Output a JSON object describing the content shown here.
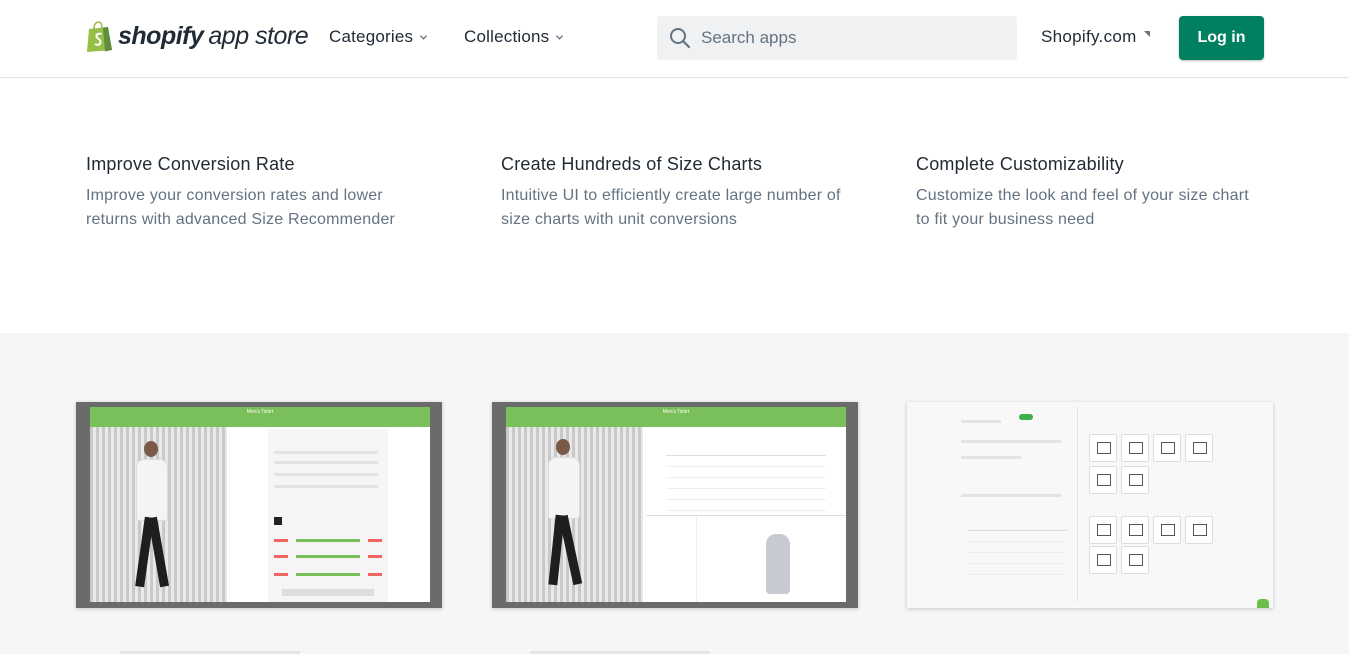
{
  "header": {
    "logo_word": "shopify",
    "logo_sub": "app store",
    "nav": [
      {
        "label": "Categories"
      },
      {
        "label": "Collections"
      }
    ],
    "search_placeholder": "Search apps",
    "shopify_link": "Shopify.com",
    "login_label": "Log in"
  },
  "features": [
    {
      "title": "Improve Conversion Rate",
      "desc": "Improve your conversion rates and lower returns with advanced Size Recommender"
    },
    {
      "title": "Create Hundreds of Size Charts",
      "desc": "Intuitive UI to efficiently create large number of size charts with unit conversions"
    },
    {
      "title": "Complete Customizability",
      "desc": "Customize the look and feel of your size chart to fit your business need"
    }
  ],
  "screenshots": [
    {
      "modal_title": "Men's Tshirt"
    },
    {
      "modal_title": "Men's Tshirt"
    },
    {
      "modal_title": ""
    }
  ],
  "colors": {
    "brand_green": "#008060",
    "accent_green": "#7ac05a",
    "text": "#212b36",
    "muted": "#637381"
  }
}
